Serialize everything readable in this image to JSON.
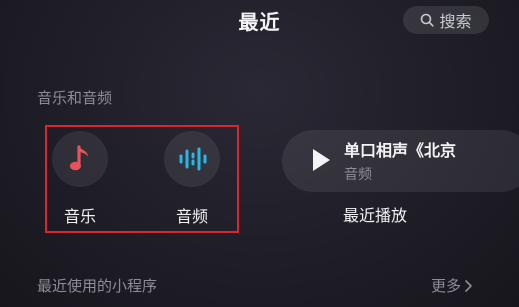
{
  "header": {
    "title": "最近",
    "search_label": "搜索"
  },
  "section_music_audio": {
    "title": "音乐和音频",
    "items": [
      {
        "label": "音乐",
        "icon": "music-note-icon",
        "color": "#e8525a"
      },
      {
        "label": "音频",
        "icon": "audio-waveform-icon",
        "color": "#29b6e8"
      }
    ]
  },
  "recent_play": {
    "title": "单口相声《北京",
    "subtitle": "音频",
    "caption": "最近播放"
  },
  "section_mini_programs": {
    "title": "最近使用的小程序",
    "more_label": "更多"
  }
}
